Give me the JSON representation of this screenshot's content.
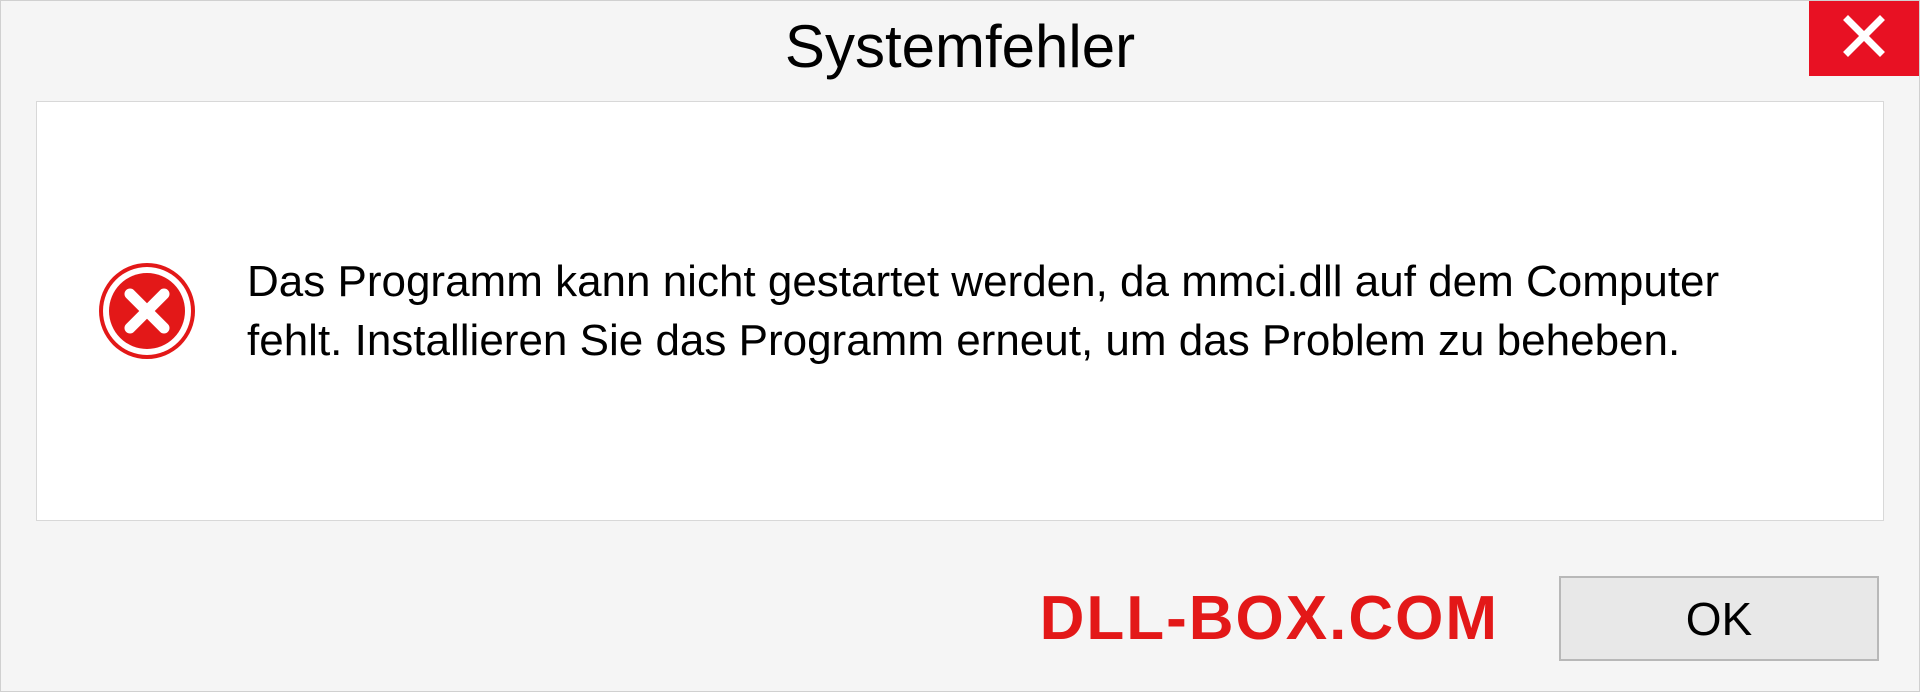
{
  "dialog": {
    "title": "Systemfehler",
    "message": "Das Programm kann nicht gestartet werden, da mmci.dll auf dem Computer fehlt. Installieren Sie das Programm erneut, um das Problem zu beheben.",
    "ok_label": "OK"
  },
  "watermark": "DLL-BOX.COM"
}
